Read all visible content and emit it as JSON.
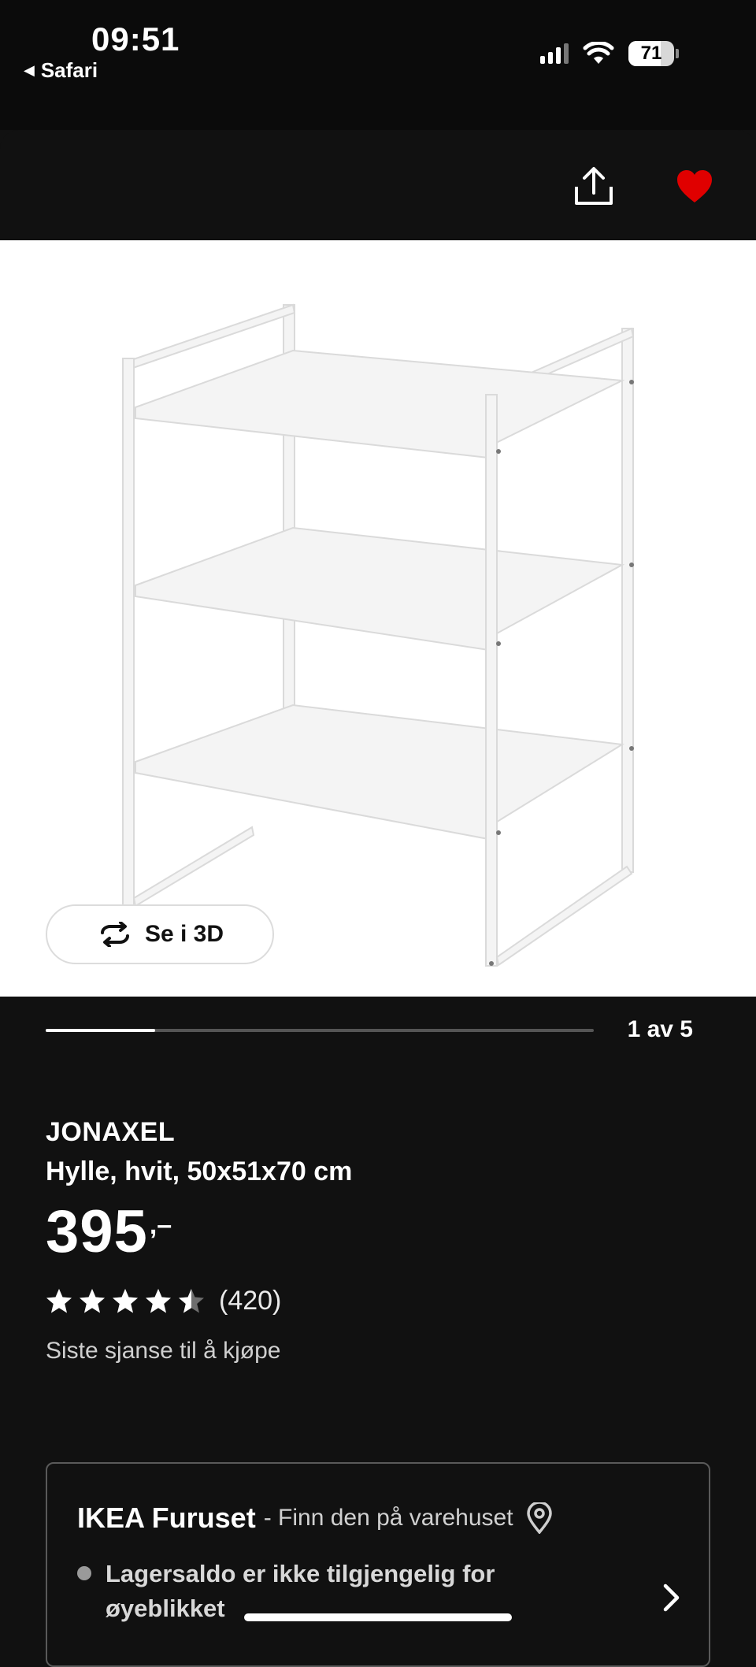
{
  "status_bar": {
    "time": "09:51",
    "back_app": "Safari",
    "battery": "71",
    "battery_level": 0.71
  },
  "topbar": {
    "share_icon": "share-icon",
    "favorite_icon": "heart-icon",
    "favorite_color": "#e00000"
  },
  "gallery": {
    "view3d_label": "Se i 3D",
    "counter": "1 av 5",
    "progress": 0.2
  },
  "product": {
    "brand": "JONAXEL",
    "description": "Hylle, hvit, 50x51x70 cm",
    "price_integer": "395",
    "price_suffix": ",–",
    "rating": 4.5,
    "rating_count": "(420)",
    "availability": "Siste sjanse til å kjøpe"
  },
  "store": {
    "name": "IKEA Furuset",
    "subtitle": "- Finn den på varehuset",
    "stock_text": "Lagersaldo er ikke tilgjengelig for øyeblikket"
  }
}
